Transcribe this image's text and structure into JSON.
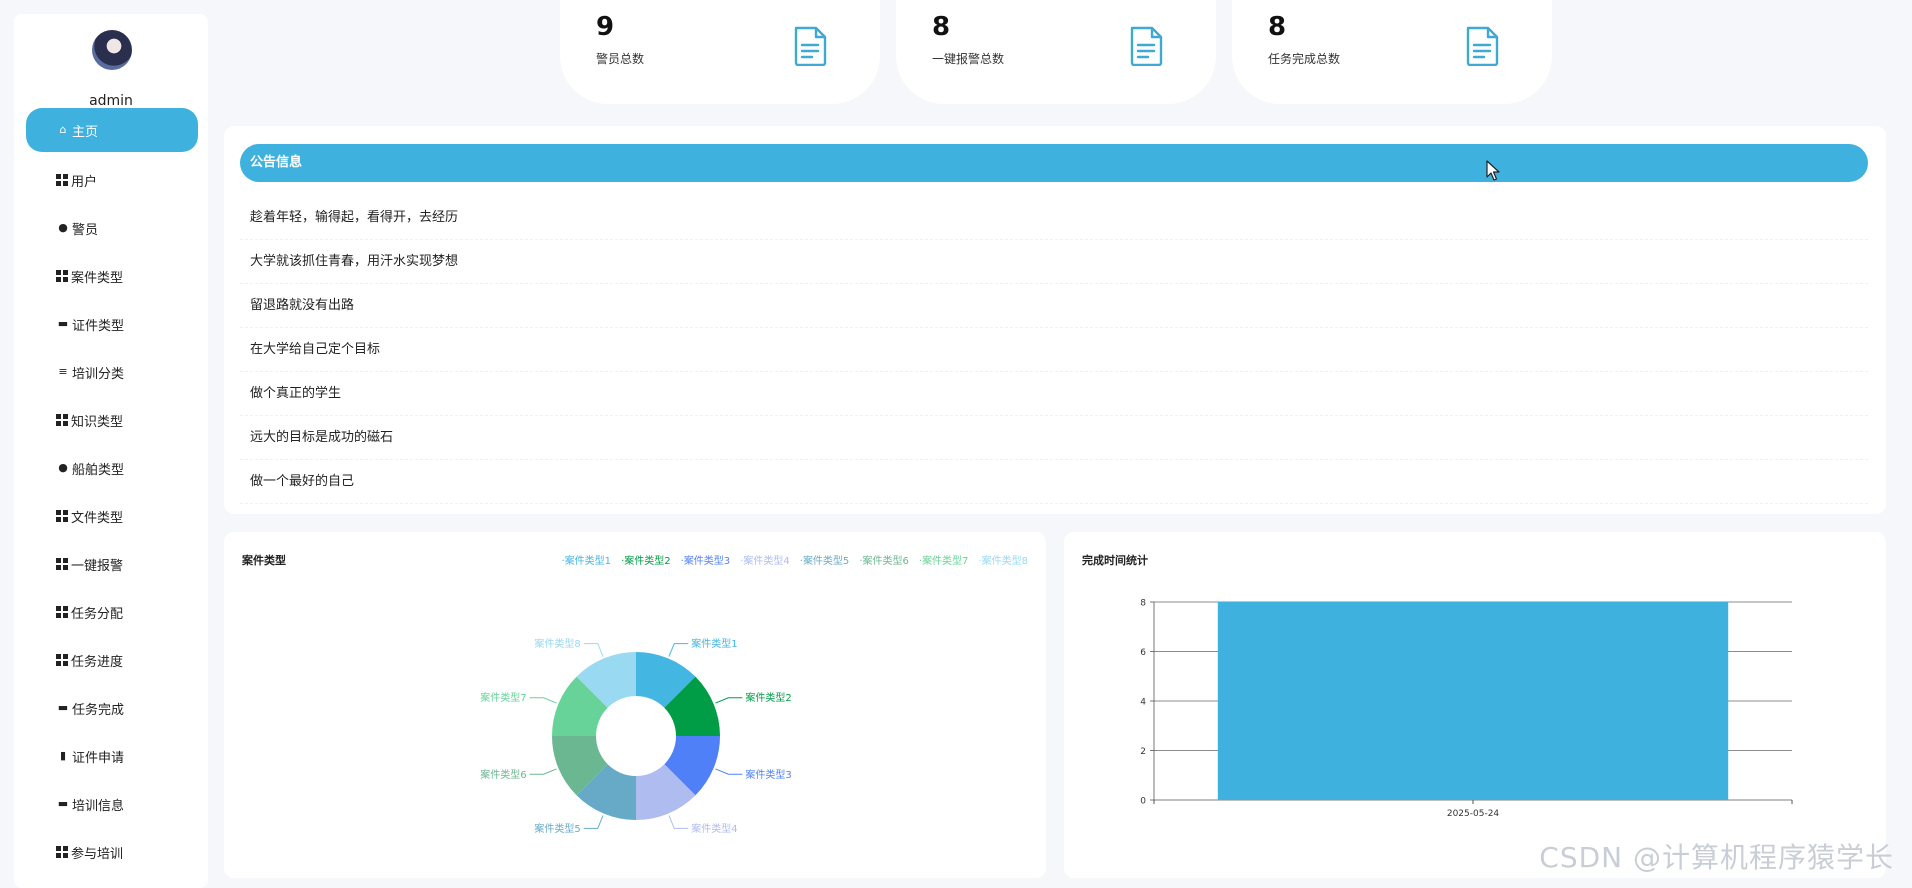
{
  "sidebar": {
    "username": "admin",
    "items": [
      {
        "label": "主页",
        "icon": "home-icon"
      },
      {
        "label": "用户",
        "icon": "grid-icon"
      },
      {
        "label": "警员",
        "icon": "user-icon"
      },
      {
        "label": "案件类型",
        "icon": "grid-icon"
      },
      {
        "label": "证件类型",
        "icon": "briefcase-icon"
      },
      {
        "label": "培训分类",
        "icon": "sliders-icon"
      },
      {
        "label": "知识类型",
        "icon": "grid-icon"
      },
      {
        "label": "船舶类型",
        "icon": "balloon-icon"
      },
      {
        "label": "文件类型",
        "icon": "grid-icon"
      },
      {
        "label": "一键报警",
        "icon": "grid-icon"
      },
      {
        "label": "任务分配",
        "icon": "grid-icon"
      },
      {
        "label": "任务进度",
        "icon": "grid-icon"
      },
      {
        "label": "任务完成",
        "icon": "tray-icon"
      },
      {
        "label": "证件申请",
        "icon": "clipboard-icon"
      },
      {
        "label": "培训信息",
        "icon": "inbox-icon"
      },
      {
        "label": "参与培训",
        "icon": "grid-icon"
      }
    ]
  },
  "stats": [
    {
      "value": "9",
      "label": "警员总数"
    },
    {
      "value": "8",
      "label": "一键报警总数"
    },
    {
      "value": "8",
      "label": "任务完成总数"
    }
  ],
  "notice": {
    "title": "公告信息",
    "items": [
      "趁着年轻，输得起，看得开，去经历",
      "大学就该抓住青春，用汗水实现梦想",
      "留退路就没有出路",
      "在大学给自己定个目标",
      "做个真正的学生",
      "远大的目标是成功的磁石",
      "做一个最好的自己"
    ]
  },
  "colors": {
    "accent": "#3fb1de",
    "icon": "#3fa9d2"
  },
  "watermark": "CSDN @计算机程序猿学长",
  "chart_data": [
    {
      "type": "pie",
      "title": "案件类型",
      "donut": true,
      "categories": [
        "案件类型1",
        "案件类型2",
        "案件类型3",
        "案件类型4",
        "案件类型5",
        "案件类型6",
        "案件类型7",
        "案件类型8"
      ],
      "values": [
        1,
        1,
        1,
        1,
        1,
        1,
        1,
        1
      ],
      "colors": [
        "#44b6e2",
        "#009c46",
        "#5080f8",
        "#aebcf0",
        "#66aac8",
        "#6bb791",
        "#68d398",
        "#99d9f2"
      ],
      "legend_position": "top-right"
    },
    {
      "type": "bar",
      "title": "完成时间统计",
      "categories": [
        "2025-05-24"
      ],
      "values": [
        8
      ],
      "ylim": [
        0,
        8
      ],
      "yticks": [
        "0",
        "2",
        "4",
        "6",
        "8"
      ],
      "grid": true,
      "color": "#3fb1de"
    }
  ]
}
